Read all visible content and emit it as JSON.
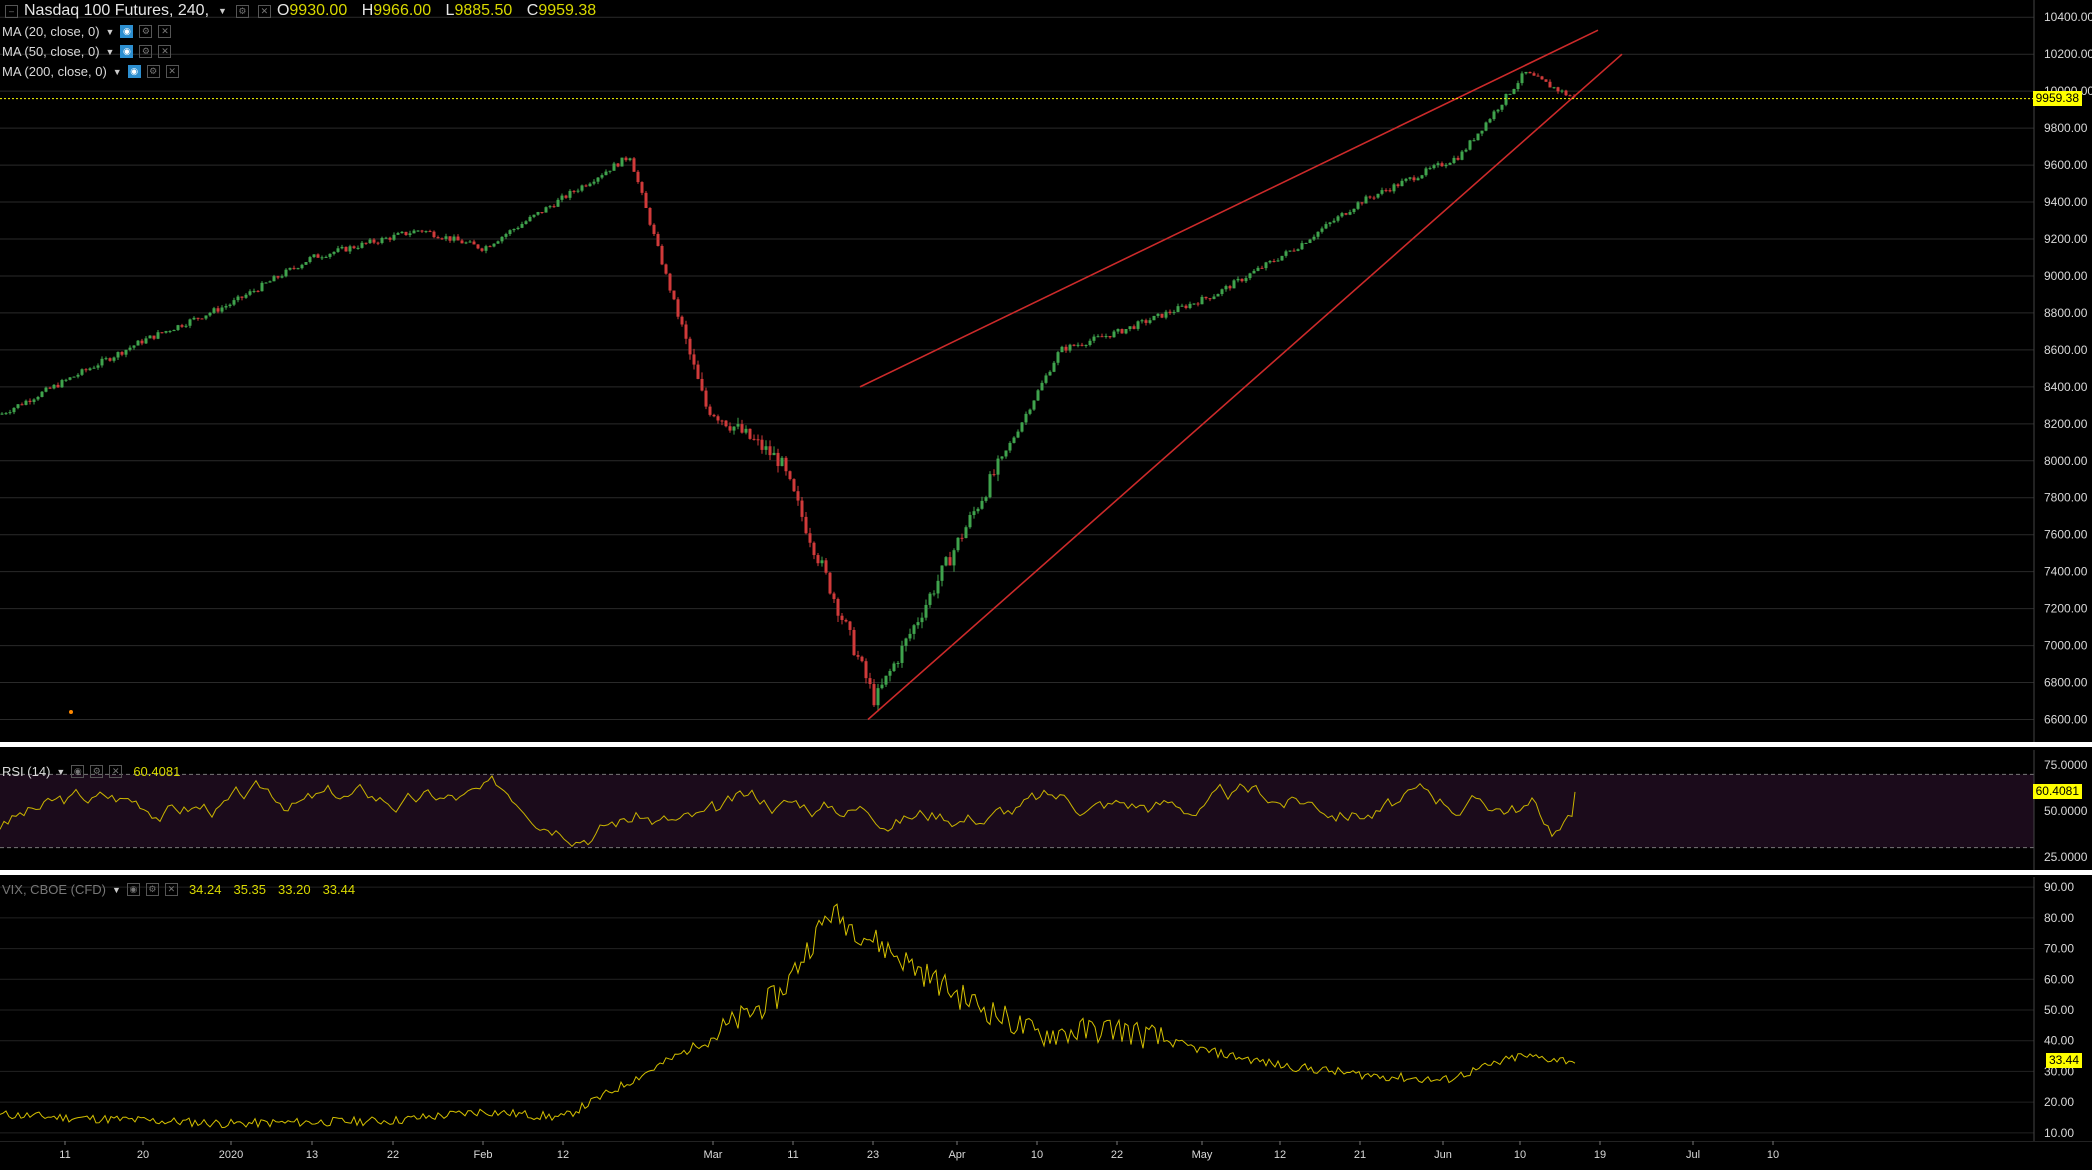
{
  "main": {
    "title": "Nasdaq 100 Futures, 240,",
    "ohlc": {
      "o_label": "O",
      "o": "9930.00",
      "h_label": "H",
      "h": "9966.00",
      "l_label": "L",
      "l": "9885.50",
      "c_label": "C",
      "c": "9959.38"
    },
    "indicators": [
      {
        "label": "MA (20, close, 0)"
      },
      {
        "label": "MA (50, close, 0)"
      },
      {
        "label": "MA (200, close, 0)"
      }
    ],
    "price_axis": [
      "10400.00",
      "10200.00",
      "10000.00",
      "9800.00",
      "9600.00",
      "9400.00",
      "9200.00",
      "9000.00",
      "8800.00",
      "8600.00",
      "8400.00",
      "8200.00",
      "8000.00",
      "7800.00",
      "7600.00",
      "7400.00",
      "7200.00",
      "7000.00",
      "6800.00",
      "6600.00"
    ],
    "last_price": "9959.38"
  },
  "rsi": {
    "label": "RSI (14)",
    "value": "60.4081",
    "axis": [
      "75.0000",
      "50.0000",
      "25.0000"
    ],
    "last": "60.4081"
  },
  "vix": {
    "label": "VIX, CBOE (CFD)",
    "values": [
      "34.24",
      "35.35",
      "33.20",
      "33.44"
    ],
    "axis": [
      "90.00",
      "80.00",
      "70.00",
      "60.00",
      "50.00",
      "40.00",
      "30.00",
      "20.00",
      "10.00"
    ],
    "last": "33.44"
  },
  "time_axis": [
    "11",
    "20",
    "2020",
    "13",
    "22",
    "Feb",
    "12",
    "Mar",
    "11",
    "23",
    "Apr",
    "10",
    "22",
    "May",
    "12",
    "21",
    "Jun",
    "10",
    "19",
    "Jul",
    "10"
  ],
  "colors": {
    "up": "#3fa34d",
    "down": "#d03a3a",
    "trend": "#cc2a2a",
    "price_line": "#ffff00",
    "rsi_line": "#c9b400",
    "vix_line": "#d4c000"
  },
  "chart_data": [
    {
      "type": "candlestick",
      "title": "Nasdaq 100 Futures, 240,",
      "x_ticks": [
        "11",
        "20",
        "2020",
        "13",
        "22",
        "Feb",
        "12",
        "Mar",
        "11",
        "23",
        "Apr",
        "10",
        "22",
        "May",
        "12",
        "21",
        "Jun",
        "10",
        "19",
        "Jul",
        "10"
      ],
      "ylim": [
        6500,
        10450
      ],
      "key_closes": [
        {
          "x": "11",
          "y": 8250
        },
        {
          "x": "20",
          "y": 8650
        },
        {
          "x": "2020",
          "y": 8850
        },
        {
          "x": "13",
          "y": 9100
        },
        {
          "x": "22",
          "y": 9250
        },
        {
          "x": "Feb",
          "y": 9150
        },
        {
          "x": "12",
          "y": 9650
        },
        {
          "x": "Mar",
          "y": 8300
        },
        {
          "x": "11",
          "y": 8000
        },
        {
          "x": "23",
          "y": 6700
        },
        {
          "x": "Apr",
          "y": 7550
        },
        {
          "x": "10",
          "y": 8600
        },
        {
          "x": "22",
          "y": 8700
        },
        {
          "x": "May",
          "y": 8900
        },
        {
          "x": "12",
          "y": 9150
        },
        {
          "x": "21",
          "y": 9400
        },
        {
          "x": "Jun",
          "y": 9650
        },
        {
          "x": "10",
          "y": 10100
        },
        {
          "x": "19",
          "y": 9959.38
        }
      ]
    },
    {
      "type": "line",
      "title": "RSI (14)",
      "ylim": [
        20,
        80
      ],
      "last": 60.4081
    },
    {
      "type": "line",
      "title": "VIX, CBOE (CFD)",
      "ylim": [
        8,
        92
      ],
      "key_points": [
        {
          "x": "11",
          "y": 15
        },
        {
          "x": "2020",
          "y": 13
        },
        {
          "x": "22",
          "y": 14
        },
        {
          "x": "Feb",
          "y": 17
        },
        {
          "x": "12",
          "y": 15
        },
        {
          "x": "Mar",
          "y": 40
        },
        {
          "x": "11",
          "y": 55
        },
        {
          "x": "23",
          "y": 82
        },
        {
          "x": "Apr",
          "y": 55
        },
        {
          "x": "10",
          "y": 42
        },
        {
          "x": "22",
          "y": 44
        },
        {
          "x": "May",
          "y": 37
        },
        {
          "x": "12",
          "y": 32
        },
        {
          "x": "21",
          "y": 29
        },
        {
          "x": "Jun",
          "y": 27
        },
        {
          "x": "10",
          "y": 35
        },
        {
          "x": "19",
          "y": 33.44
        }
      ]
    }
  ]
}
